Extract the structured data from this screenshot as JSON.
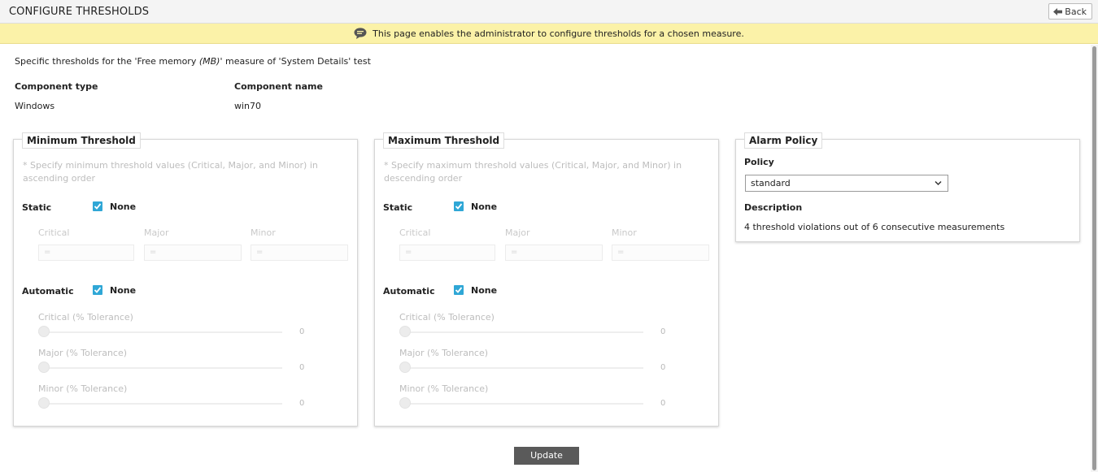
{
  "header": {
    "title": "CONFIGURE THRESHOLDS",
    "back_label": "Back"
  },
  "banner": {
    "text": "This page enables the administrator to configure thresholds for a chosen measure."
  },
  "description": {
    "prefix": "Specific thresholds for the 'Free memory ",
    "unit": "(MB)",
    "suffix": "' measure of 'System Details' test"
  },
  "component": {
    "type_label": "Component type",
    "type_value": "Windows",
    "name_label": "Component name",
    "name_value": "win70"
  },
  "min_panel": {
    "title": "Minimum Threshold",
    "hint": "* Specify minimum threshold values (Critical, Major, and Minor) in ascending order",
    "static_label": "Static",
    "static_none": "None",
    "columns": [
      "Critical",
      "Major",
      "Minor"
    ],
    "inputs": [
      "=",
      "=",
      "="
    ],
    "automatic_label": "Automatic",
    "automatic_none": "None",
    "tolerances": [
      {
        "label": "Critical (% Tolerance)",
        "value": "0"
      },
      {
        "label": "Major (% Tolerance)",
        "value": "0"
      },
      {
        "label": "Minor (% Tolerance)",
        "value": "0"
      }
    ]
  },
  "max_panel": {
    "title": "Maximum Threshold",
    "hint": "* Specify maximum threshold values (Critical, Major, and Minor) in descending order",
    "static_label": "Static",
    "static_none": "None",
    "columns": [
      "Critical",
      "Major",
      "Minor"
    ],
    "inputs": [
      "=",
      "=",
      "="
    ],
    "automatic_label": "Automatic",
    "automatic_none": "None",
    "tolerances": [
      {
        "label": "Critical (% Tolerance)",
        "value": "0"
      },
      {
        "label": "Major (% Tolerance)",
        "value": "0"
      },
      {
        "label": "Minor (% Tolerance)",
        "value": "0"
      }
    ]
  },
  "alarm_panel": {
    "title": "Alarm Policy",
    "policy_label": "Policy",
    "policy_value": "standard",
    "description_label": "Description",
    "description_value": "4 threshold violations out of 6 consecutive measurements"
  },
  "update_label": "Update",
  "colors": {
    "banner": "#fbf2a8",
    "checkbox": "#2fa7d6",
    "update_button": "#5a5a5a"
  }
}
